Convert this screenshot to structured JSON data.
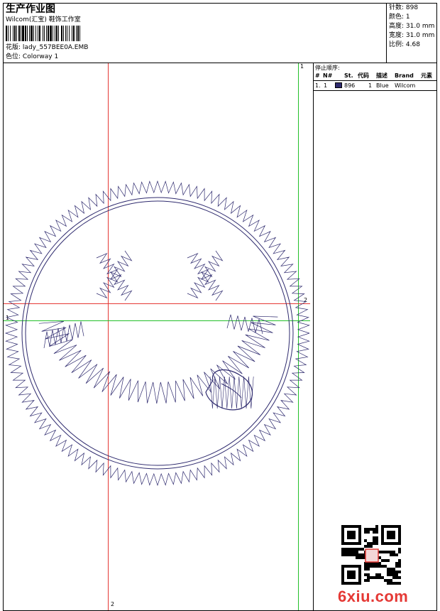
{
  "header": {
    "title": "生产作业图",
    "company": "Wilcom(汇宝) 鞋饰工作室",
    "design_label": "花版:",
    "design_file": "lady_557BEE0A.EMB",
    "colorway_label": "色位:",
    "colorway": "Colorway 1"
  },
  "stats": {
    "stitches_label": "针数:",
    "stitches": "898",
    "colors_label": "颜色:",
    "colors": "1",
    "height_label": "高度:",
    "height": "31.0 mm",
    "width_label": "宽度:",
    "width": "31.0 mm",
    "scale_label": "比例:",
    "scale": "4.68"
  },
  "stop_sequence": {
    "title": "停止顺序:",
    "columns": [
      "#",
      "N#",
      "St.",
      "代码",
      "描述",
      "Brand",
      "元素"
    ],
    "rows": [
      {
        "index": "1.",
        "needle": "1",
        "stitches": "896",
        "code": "1",
        "description": "Blue",
        "brand": "Wilcom",
        "element": "",
        "color": "#2e2a6e"
      }
    ]
  },
  "guides": {
    "vertical_red_label": "2",
    "vertical_green_label": "1",
    "horizontal_red_label": "2",
    "horizontal_green_label": "1"
  },
  "colors": {
    "thread": "#2e2a6e",
    "guide_red": "#e53935",
    "guide_green": "#22c02a"
  },
  "watermark": {
    "text": "6xiu.com",
    "qr_icon": "qr-code-icon"
  }
}
